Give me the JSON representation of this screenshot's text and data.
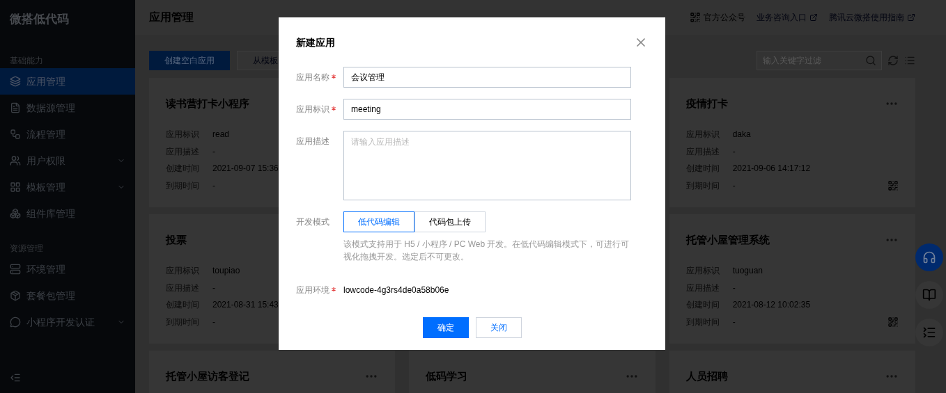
{
  "sidebar": {
    "logo": "微搭低代码",
    "sections": [
      {
        "title": "基础能力",
        "items": [
          {
            "label": "应用管理",
            "selected": true,
            "expandable": false
          },
          {
            "label": "数据源管理",
            "selected": false,
            "expandable": false
          },
          {
            "label": "流程管理",
            "selected": false,
            "expandable": false
          },
          {
            "label": "用户权限",
            "selected": false,
            "expandable": true
          },
          {
            "label": "模板管理",
            "selected": false,
            "expandable": true
          },
          {
            "label": "组件库管理",
            "selected": false,
            "expandable": false
          }
        ]
      },
      {
        "title": "资源管理",
        "items": [
          {
            "label": "环境管理",
            "selected": false,
            "expandable": false
          },
          {
            "label": "套餐包管理",
            "selected": false,
            "expandable": false
          },
          {
            "label": "小程序开发认证",
            "selected": false,
            "expandable": true
          }
        ]
      }
    ]
  },
  "header": {
    "title": "应用管理",
    "links": [
      {
        "label": "官方公众号",
        "kind": "qr"
      },
      {
        "label": "业务咨询入口",
        "kind": "external"
      },
      {
        "label": "腾讯云微搭使用指南",
        "kind": "external"
      }
    ]
  },
  "toolbar": {
    "primary_button": "创建空白应用",
    "secondary_button": "从模板",
    "search": {
      "placeholder": "输入关键字过滤"
    }
  },
  "card_columns": [
    {
      "cards": [
        {
          "title": "读书营打卡小程序",
          "rows": [
            {
              "label": "应用标识",
              "value": "read"
            },
            {
              "label": "应用描述",
              "value": "-"
            },
            {
              "label": "创建时间",
              "value": "2021-09-07 15:36"
            },
            {
              "label": "到期时间",
              "value": "-"
            }
          ]
        },
        {
          "title": "投票",
          "rows": [
            {
              "label": "应用标识",
              "value": "toupiao"
            },
            {
              "label": "应用描述",
              "value": "-"
            },
            {
              "label": "创建时间",
              "value": "2021-08-31 15:43"
            },
            {
              "label": "到期时间",
              "value": "-"
            }
          ]
        },
        {
          "title": "托管小屋访客登记",
          "show_actions": true
        }
      ]
    },
    {
      "cards": [
        {
          "title": "低码学习",
          "show_actions": true
        }
      ]
    },
    {
      "cards": [
        {
          "title": "疫情打卡",
          "show_actions": true,
          "rows": [
            {
              "label": "应用标识",
              "value": "daka"
            },
            {
              "label": "应用描述",
              "value": "-"
            },
            {
              "label": "创建时间",
              "value": "2021-09-06 14:17:12"
            },
            {
              "label": "到期时间",
              "value": "-"
            }
          ]
        },
        {
          "title": "托管小屋管理系统",
          "show_actions": true,
          "rows": [
            {
              "label": "应用标识",
              "value": "tuoguan"
            },
            {
              "label": "应用描述",
              "value": "-"
            },
            {
              "label": "创建时间",
              "value": "2021-08-12 10:02:35"
            },
            {
              "label": "到期时间",
              "value": "-"
            }
          ]
        },
        {
          "title": "人员招聘",
          "show_actions": true
        }
      ]
    }
  ],
  "dialog": {
    "title": "新建应用",
    "fields": [
      {
        "kind": "input",
        "label": "应用名称",
        "required": true,
        "value": "会议管理"
      },
      {
        "kind": "input",
        "label": "应用标识",
        "required": true,
        "value": "meeting"
      },
      {
        "kind": "textarea",
        "label": "应用描述",
        "required": false,
        "placeholder": "请输入应用描述"
      },
      {
        "kind": "segmented",
        "label": "开发模式",
        "required": false,
        "options": [
          {
            "label": "低代码编辑",
            "selected": true
          },
          {
            "label": "代码包上传",
            "selected": false
          }
        ],
        "help": "该模式支持用于 H5 / 小程序 / PC Web 开发。在低代码编辑模式下，可进行可视化拖拽开发。选定后不可更改。"
      },
      {
        "kind": "text",
        "label": "应用环境",
        "required": true,
        "value": "lowcode-4g3rs4de0a58b06e"
      }
    ],
    "buttons": [
      {
        "label": "确定",
        "kind": "primary"
      },
      {
        "label": "关闭",
        "kind": "secondary"
      }
    ]
  }
}
